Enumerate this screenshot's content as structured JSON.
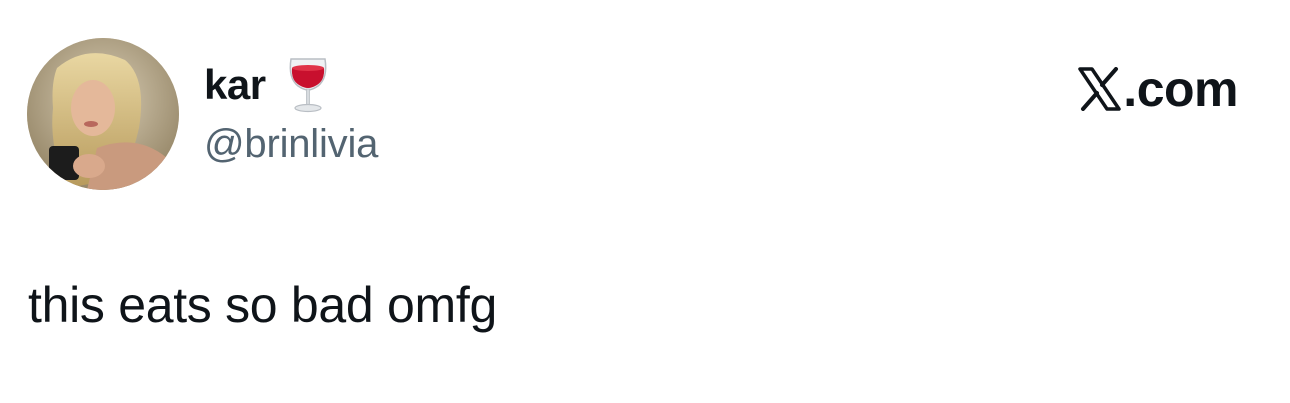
{
  "user": {
    "display_name": "kar",
    "emoji": "wine-glass-icon",
    "handle": "@brinlivia"
  },
  "brand": {
    "logo": "x-logo-icon",
    "domain_suffix": ".com"
  },
  "tweet": {
    "text": "this eats so bad omfg"
  }
}
